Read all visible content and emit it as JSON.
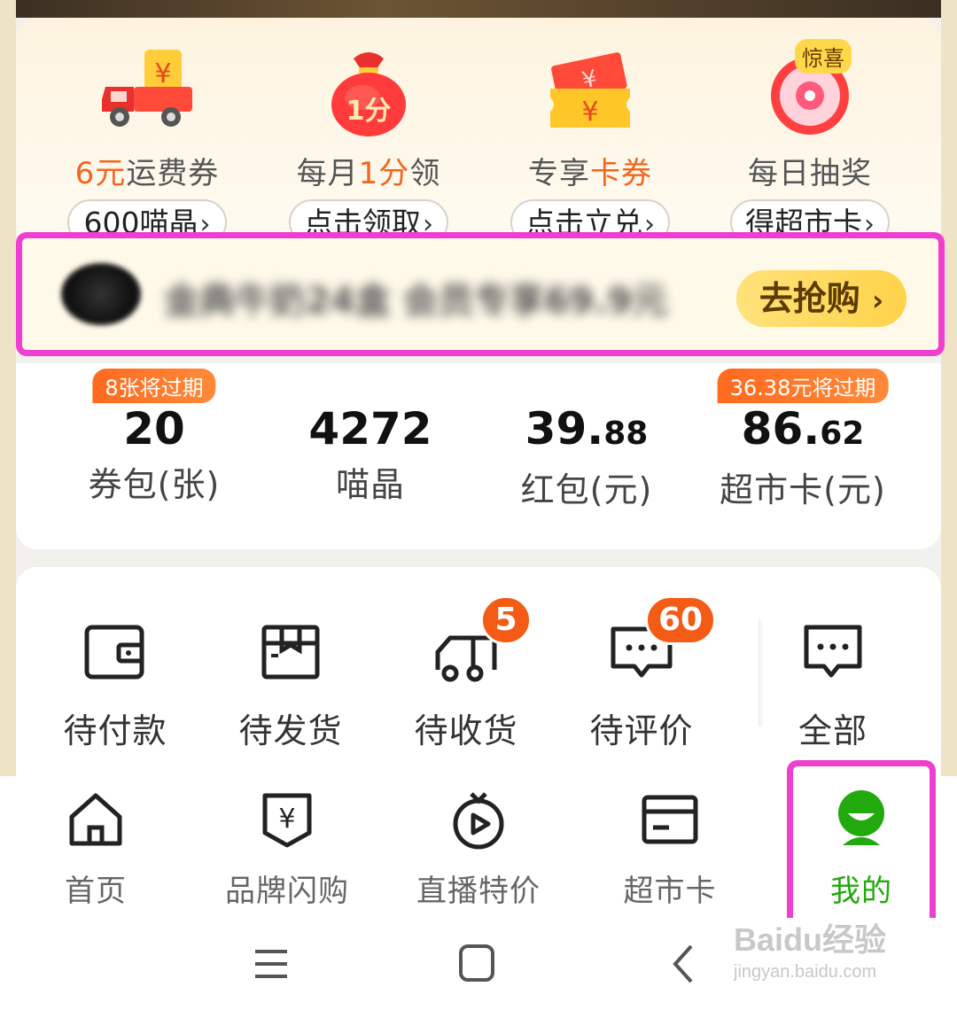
{
  "benefits": [
    {
      "title_hl": "6元",
      "title_rest": "运费券",
      "pill": "600喵晶",
      "icon": "truck-coupon-icon"
    },
    {
      "title_pre": "每月",
      "title_hl": "1分",
      "title_rest": "领",
      "pill": "点击领取",
      "icon": "money-bag-icon",
      "icon_text": "1分"
    },
    {
      "title_pre": "专享",
      "title_hl": "卡券",
      "pill": "点击立兑",
      "icon": "ticket-icon"
    },
    {
      "title_pre": "每日抽奖",
      "pill": "得超市卡",
      "icon": "lottery-wheel-icon",
      "badge": "惊喜"
    }
  ],
  "promo": {
    "text": "金典牛奶24盒 会员专享69.9元",
    "button": "去抢购",
    "chevron": "›"
  },
  "stats": [
    {
      "badge": "8张将过期",
      "num": "20",
      "label": "券包(张)"
    },
    {
      "num": "4272",
      "label": "喵晶"
    },
    {
      "num_int": "39.",
      "num_dec": "88",
      "label": "红包(元)"
    },
    {
      "badge": "36.38元将过期",
      "num_int": "86.",
      "num_dec": "62",
      "label": "超市卡(元)"
    }
  ],
  "orders": [
    {
      "label": "待付款",
      "icon": "wallet-icon"
    },
    {
      "label": "待发货",
      "icon": "package-icon"
    },
    {
      "label": "待收货",
      "icon": "delivery-truck-icon",
      "count": "5"
    },
    {
      "label": "待评价",
      "icon": "review-bubble-icon",
      "count": "60"
    },
    {
      "label": "全部",
      "icon": "all-orders-icon"
    }
  ],
  "tabs": [
    {
      "label": "首页",
      "icon": "home-icon"
    },
    {
      "label": "品牌闪购",
      "icon": "brand-flash-icon"
    },
    {
      "label": "直播特价",
      "icon": "live-icon"
    },
    {
      "label": "超市卡",
      "icon": "card-icon"
    },
    {
      "label": "我的",
      "icon": "profile-icon",
      "active": true
    }
  ],
  "chevron": "›",
  "watermark": {
    "main": "Baidu经验",
    "sub": "jingyan.baidu.com"
  },
  "colors": {
    "accent": "#f2651c",
    "active": "#21a90d",
    "highlight": "#ee3fd0"
  }
}
